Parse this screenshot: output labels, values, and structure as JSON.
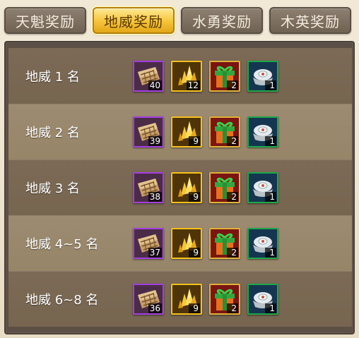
{
  "tabs": [
    {
      "label": "天魁奖励",
      "active": false
    },
    {
      "label": "地威奖励",
      "active": true
    },
    {
      "label": "水勇奖励",
      "active": false
    },
    {
      "label": "木英奖励",
      "active": false
    }
  ],
  "rows": [
    {
      "rank": "地威 1 名",
      "counts": [
        "40",
        "12",
        "2",
        "1"
      ]
    },
    {
      "rank": "地威 2 名",
      "counts": [
        "39",
        "9",
        "2",
        "1"
      ]
    },
    {
      "rank": "地威 3 名",
      "counts": [
        "38",
        "9",
        "2",
        "1"
      ]
    },
    {
      "rank": "地威 4~5 名",
      "counts": [
        "37",
        "9",
        "2",
        "1"
      ]
    },
    {
      "rank": "地威 6~8 名",
      "counts": [
        "36",
        "9",
        "2",
        "1"
      ]
    }
  ],
  "item_icons": [
    "treasure-map-icon",
    "gold-crystal-icon",
    "gift-box-icon",
    "silver-ingot-icon"
  ],
  "colors": {
    "active_tab": "#f6c43a",
    "inactive_tab": "#7f7262",
    "row_dark": "#7a6853",
    "row_light": "#9a886d",
    "border_purple": "#a33fe0",
    "border_gold": "#f5c21e",
    "border_red": "#e0b23a",
    "border_green": "#1fa64a"
  }
}
